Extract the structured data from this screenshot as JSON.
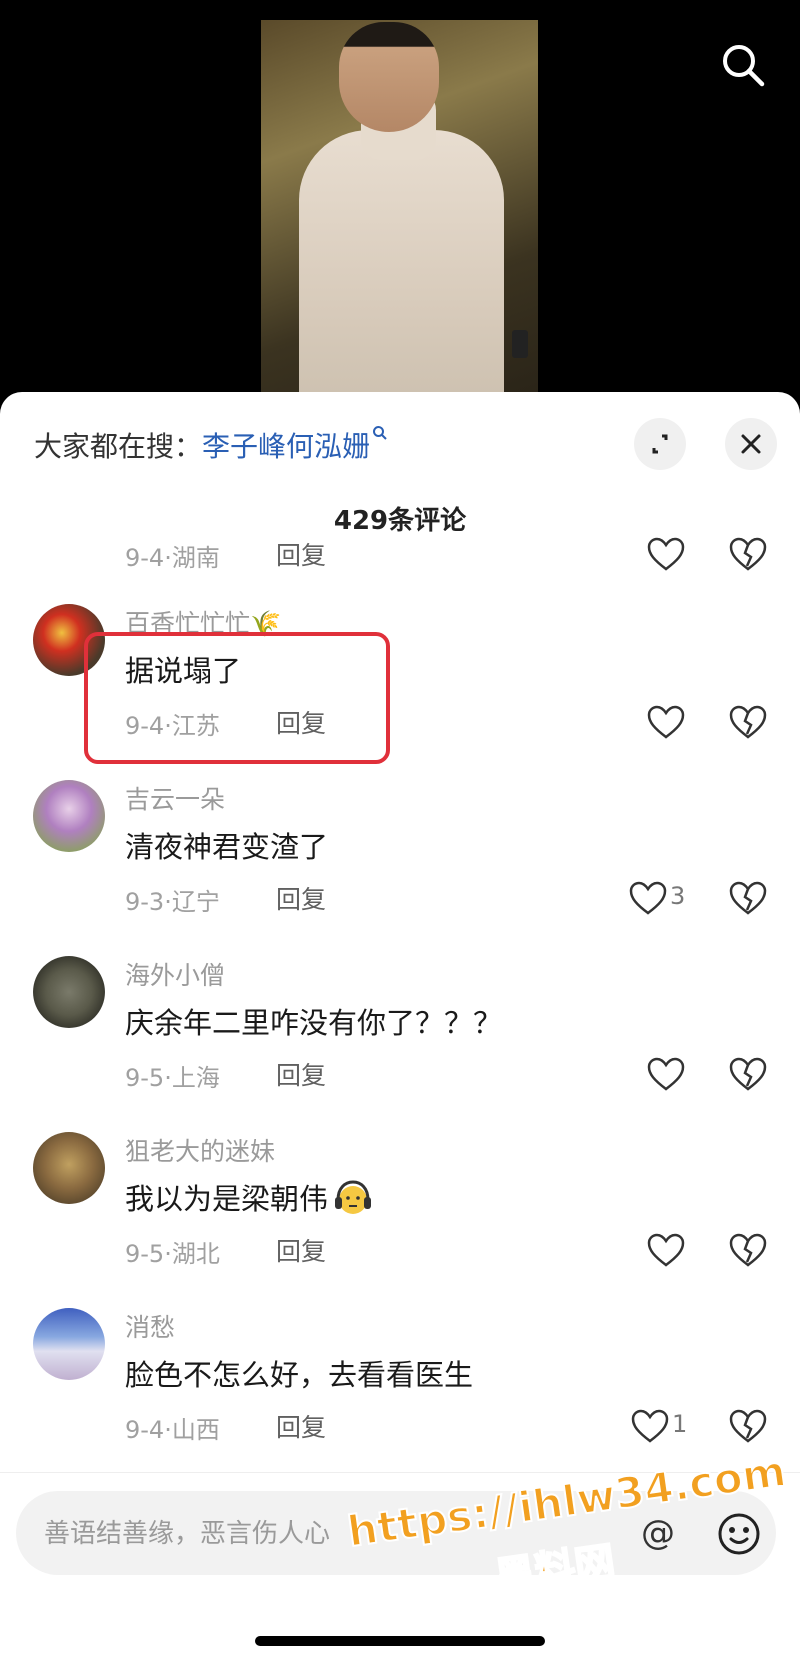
{
  "top_search": {
    "prefix": "大家都在搜：",
    "keyword": "李子峰何泓姗"
  },
  "comments_count": "429条评论",
  "comments": [
    {
      "meta": "9-4·湖南",
      "reply": "回复"
    },
    {
      "name": "百香忙忙忙🌾",
      "text": "据说塌了",
      "meta": "9-4·江苏",
      "reply": "回复"
    },
    {
      "name": "吉云一朵",
      "text": "清夜神君变渣了",
      "meta": "9-3·辽宁",
      "reply": "回复",
      "likes": "3"
    },
    {
      "name": "海外小僧",
      "text": "庆余年二里咋没有你了？？？",
      "meta": "9-5·上海",
      "reply": "回复"
    },
    {
      "name": "狙老大的迷妹",
      "text": "我以为是梁朝伟",
      "meta": "9-5·湖北",
      "reply": "回复"
    },
    {
      "name": "消愁",
      "text": "脸色不怎么好，去看看医生",
      "meta": "9-4·山西",
      "reply": "回复",
      "likes": "1"
    }
  ],
  "input": {
    "placeholder": "善语结善缘，恶言伤人心"
  },
  "watermark": {
    "url": "https://ihlw34.com",
    "name": "黑料网"
  },
  "colors": {
    "accent": "#2a5fb4",
    "highlight": "#e0303a",
    "watermark": "#f2a020"
  },
  "icons": [
    "search-icon",
    "expand-icon",
    "close-icon",
    "heart-icon",
    "broken-heart-icon",
    "at-icon",
    "emoji-icon"
  ]
}
